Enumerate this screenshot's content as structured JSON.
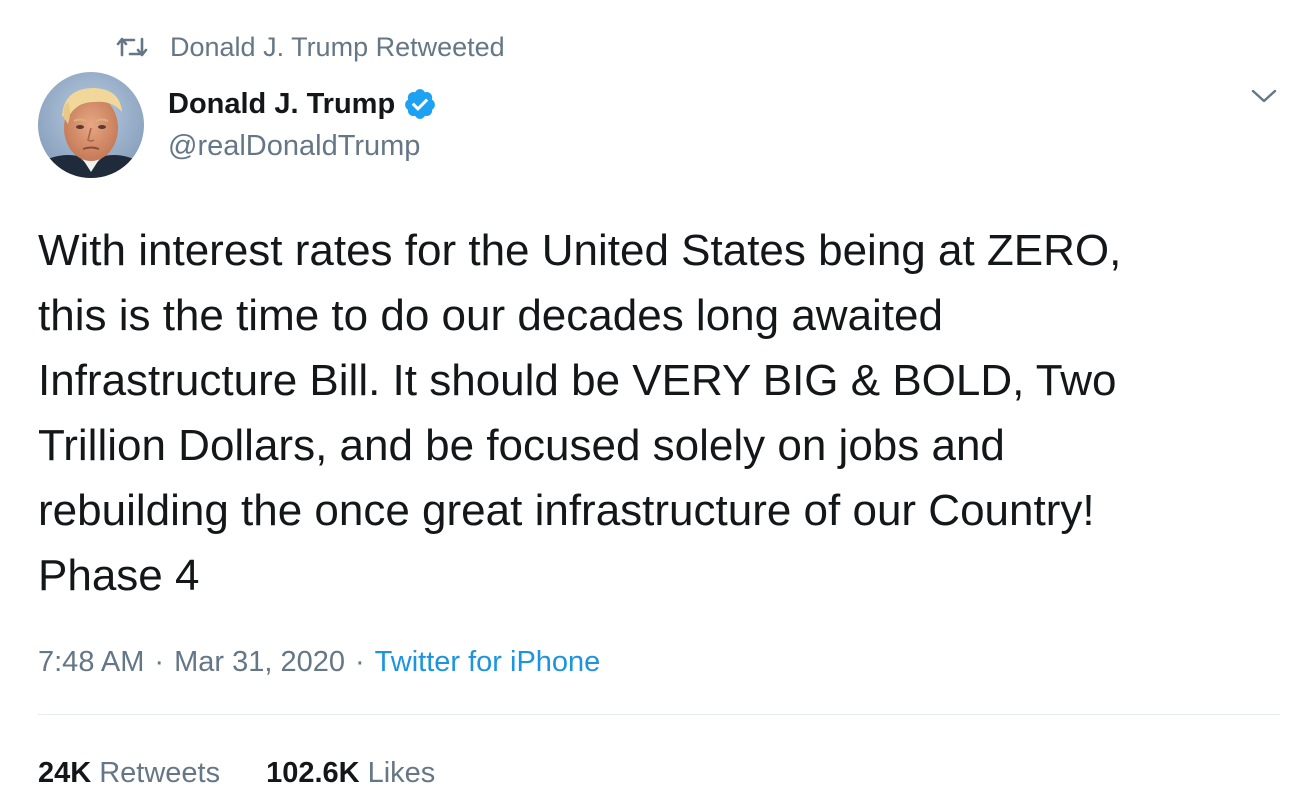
{
  "retweet_context": {
    "icon": "retweet-icon",
    "text": "Donald J. Trump Retweeted"
  },
  "author": {
    "avatar_icon": "profile-avatar",
    "display_name": "Donald J. Trump",
    "verified_icon": "verified-badge-icon",
    "handle": "@realDonaldTrump",
    "menu_icon": "chevron-down-icon"
  },
  "tweet": {
    "lines": [
      "With interest rates for the United States being at ZERO,",
      "this is the time to do our decades long awaited",
      "Infrastructure Bill. It should be VERY BIG & BOLD, Two",
      "Trillion Dollars, and be focused solely on jobs and",
      "rebuilding the once great infrastructure of our Country!",
      "Phase 4"
    ]
  },
  "meta": {
    "time": "7:48 AM",
    "separator": "·",
    "date": "Mar 31, 2020",
    "source": "Twitter for iPhone"
  },
  "stats": {
    "retweets_count": "24K",
    "retweets_label": "Retweets",
    "likes_count": "102.6K",
    "likes_label": "Likes"
  },
  "colors": {
    "text_primary": "#14171a",
    "text_secondary": "#657786",
    "link": "#1b95e0",
    "verified": "#1da1f2",
    "divider": "#e6ecf0"
  }
}
